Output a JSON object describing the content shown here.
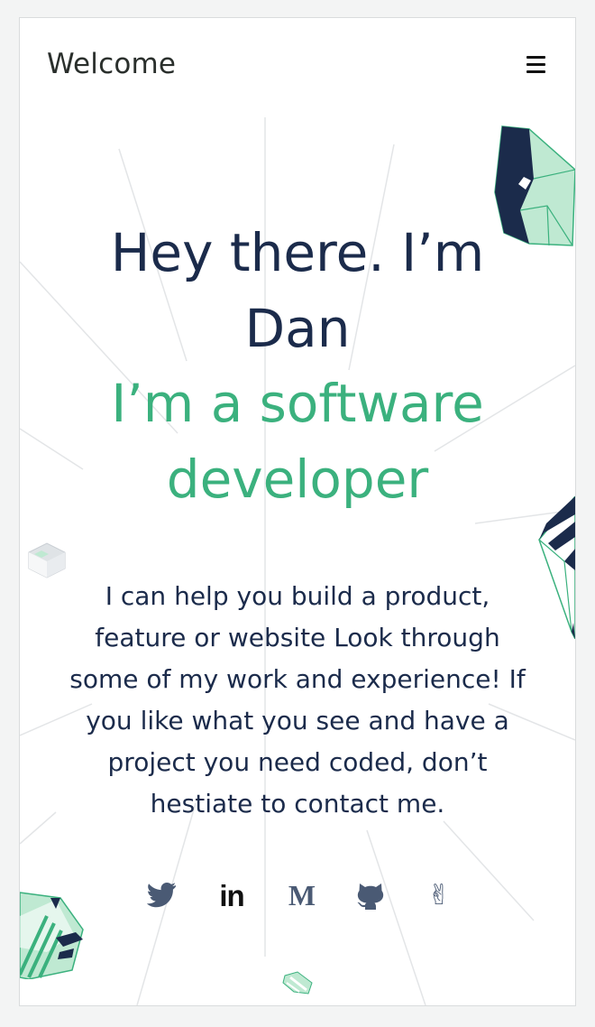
{
  "header": {
    "brand": "Welcome",
    "menu_icon": "hamburger-menu-icon"
  },
  "hero": {
    "title_line1": "Hey there. I’m",
    "title_line2": "Dan",
    "subtitle_line1": "I’m a software",
    "subtitle_line2": "developer"
  },
  "intro": {
    "lines": [
      "I can help you build a product,",
      "feature or website Look through",
      "some of my work and experience! If",
      "you like what you see and have a",
      "project you need coded, don’t",
      "hestiate to contact me."
    ]
  },
  "socials": [
    {
      "name": "twitter",
      "icon": "twitter-icon",
      "label": "",
      "color": "#4a5a74"
    },
    {
      "name": "linkedin",
      "icon": "linkedin-icon",
      "label": "in",
      "color": "#111111"
    },
    {
      "name": "medium",
      "icon": "medium-icon",
      "label": "M",
      "color": "#4a5a74"
    },
    {
      "name": "github",
      "icon": "github-icon",
      "label": "",
      "color": "#4a5a74"
    },
    {
      "name": "angellist",
      "icon": "angellist-icon",
      "label": "✌",
      "color": "#4a5a74"
    }
  ],
  "colors": {
    "navy": "#1b2b4b",
    "accent_green": "#3bb17e",
    "mint": "#bfe9d2",
    "line": "#e3e5e7"
  }
}
